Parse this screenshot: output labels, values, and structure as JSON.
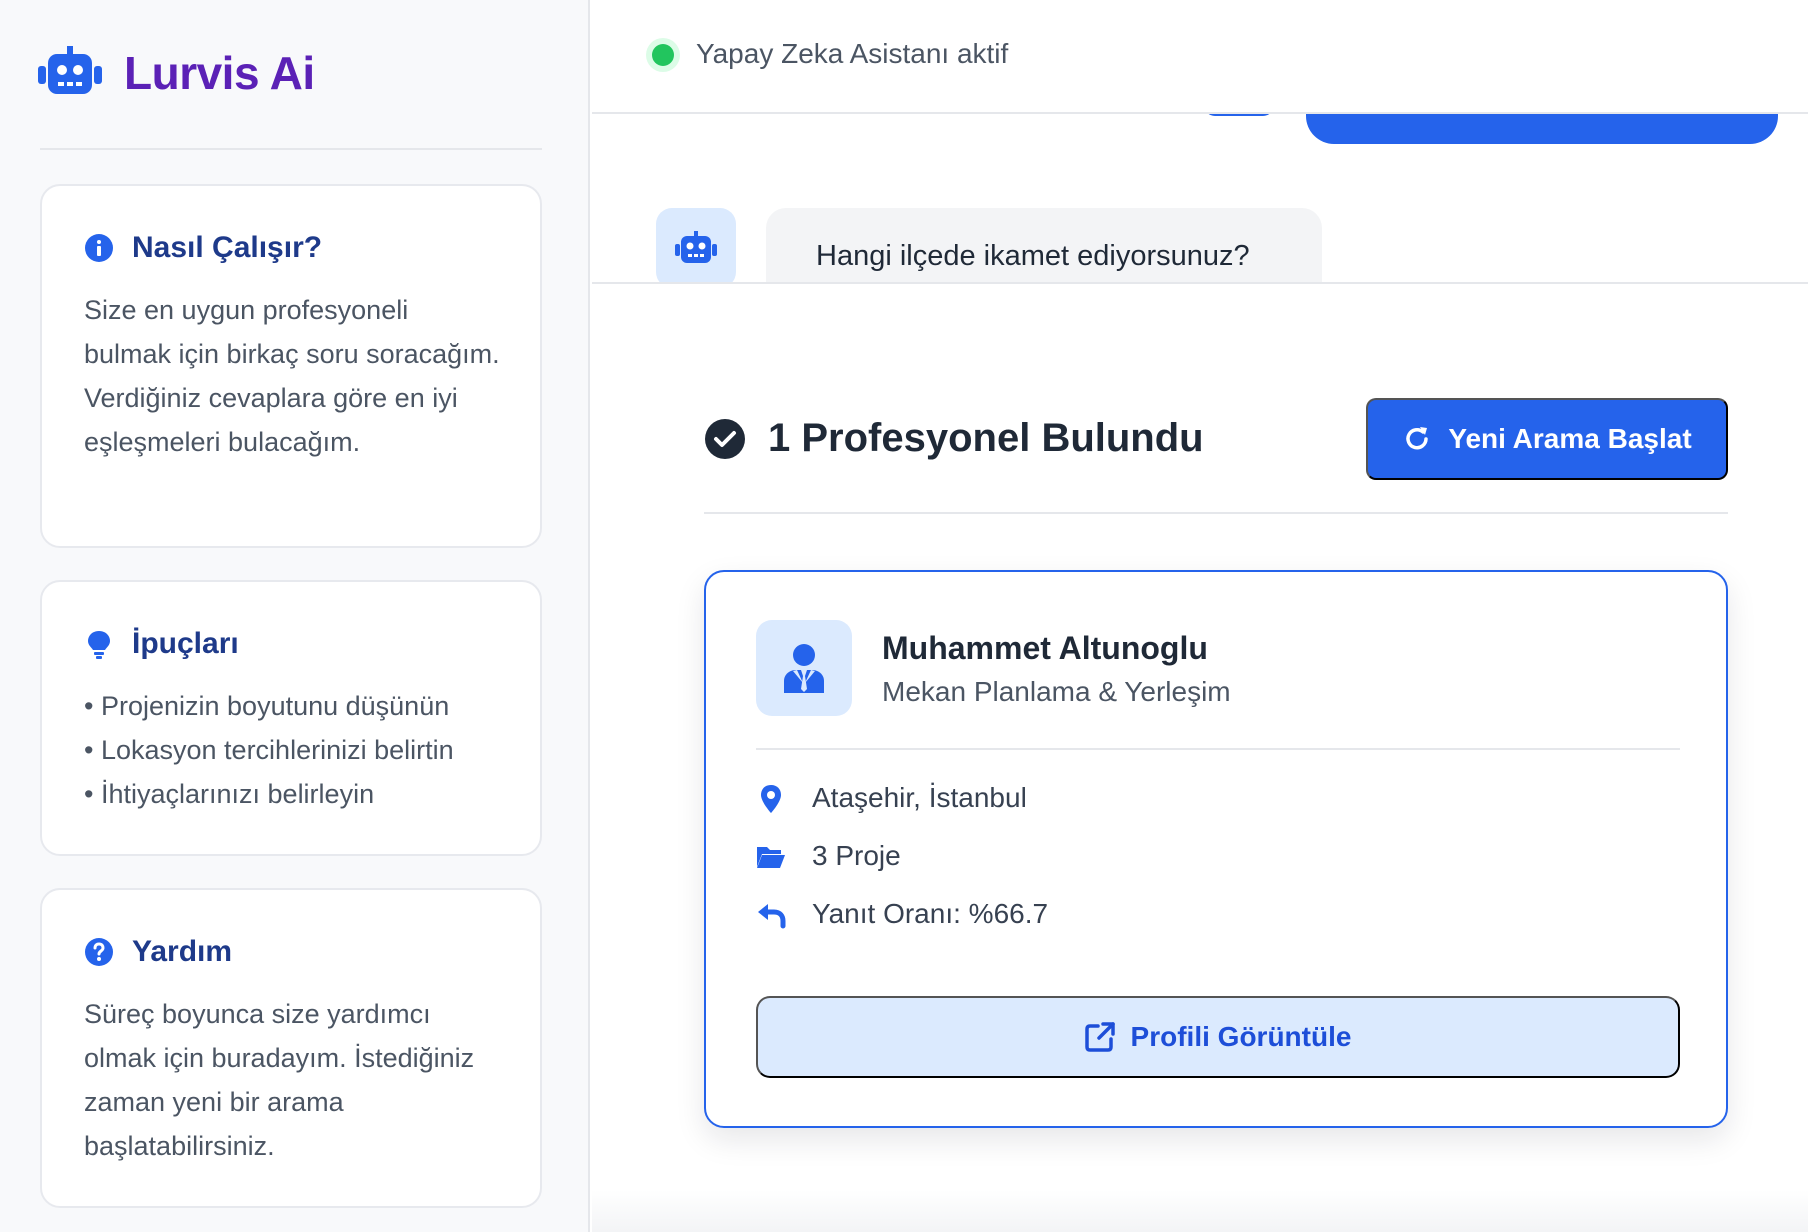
{
  "app": {
    "name": "Lurvis Ai",
    "logo_icon": "robot-icon",
    "accent_color": "#2563eb",
    "brand_color": "#5b21b6"
  },
  "sidebar": {
    "how_it_works": {
      "icon": "info-icon",
      "title": "Nasıl Çalışır?",
      "body": "Size en uygun profesyoneli bulmak için birkaç soru soracağım. Verdiğiniz cevaplara göre en iyi eşleşmeleri bulacağım."
    },
    "tips": {
      "icon": "lightbulb-icon",
      "title": "İpuçları",
      "items": [
        "Projenizin boyutunu düşünün",
        "Lokasyon tercihlerinizi belirtin",
        "İhtiyaçlarınızı belirleyin"
      ]
    },
    "help": {
      "icon": "question-icon",
      "title": "Yardım",
      "body": "Süreç boyunca size yardımcı olmak için buradayım. İstediğiniz zaman yeni bir arama başlatabilirsiniz."
    }
  },
  "status": {
    "text": "Yapay Zeka Asistanı aktif",
    "state_color": "#22c55e"
  },
  "chat": {
    "bot_message": "Hangi ilçede ikamet ediyorsunuz?"
  },
  "results": {
    "title": "1 Profesyonel Bulundu",
    "new_search_label": "Yeni Arama Başlat",
    "professional": {
      "name": "Muhammet Altunoglu",
      "role": "Mekan Planlama & Yerleşim",
      "location": "Ataşehir, İstanbul",
      "projects": "3 Proje",
      "response_rate": "Yanıt Oranı: %66.7",
      "profile_button_label": "Profili Görüntüle"
    }
  }
}
